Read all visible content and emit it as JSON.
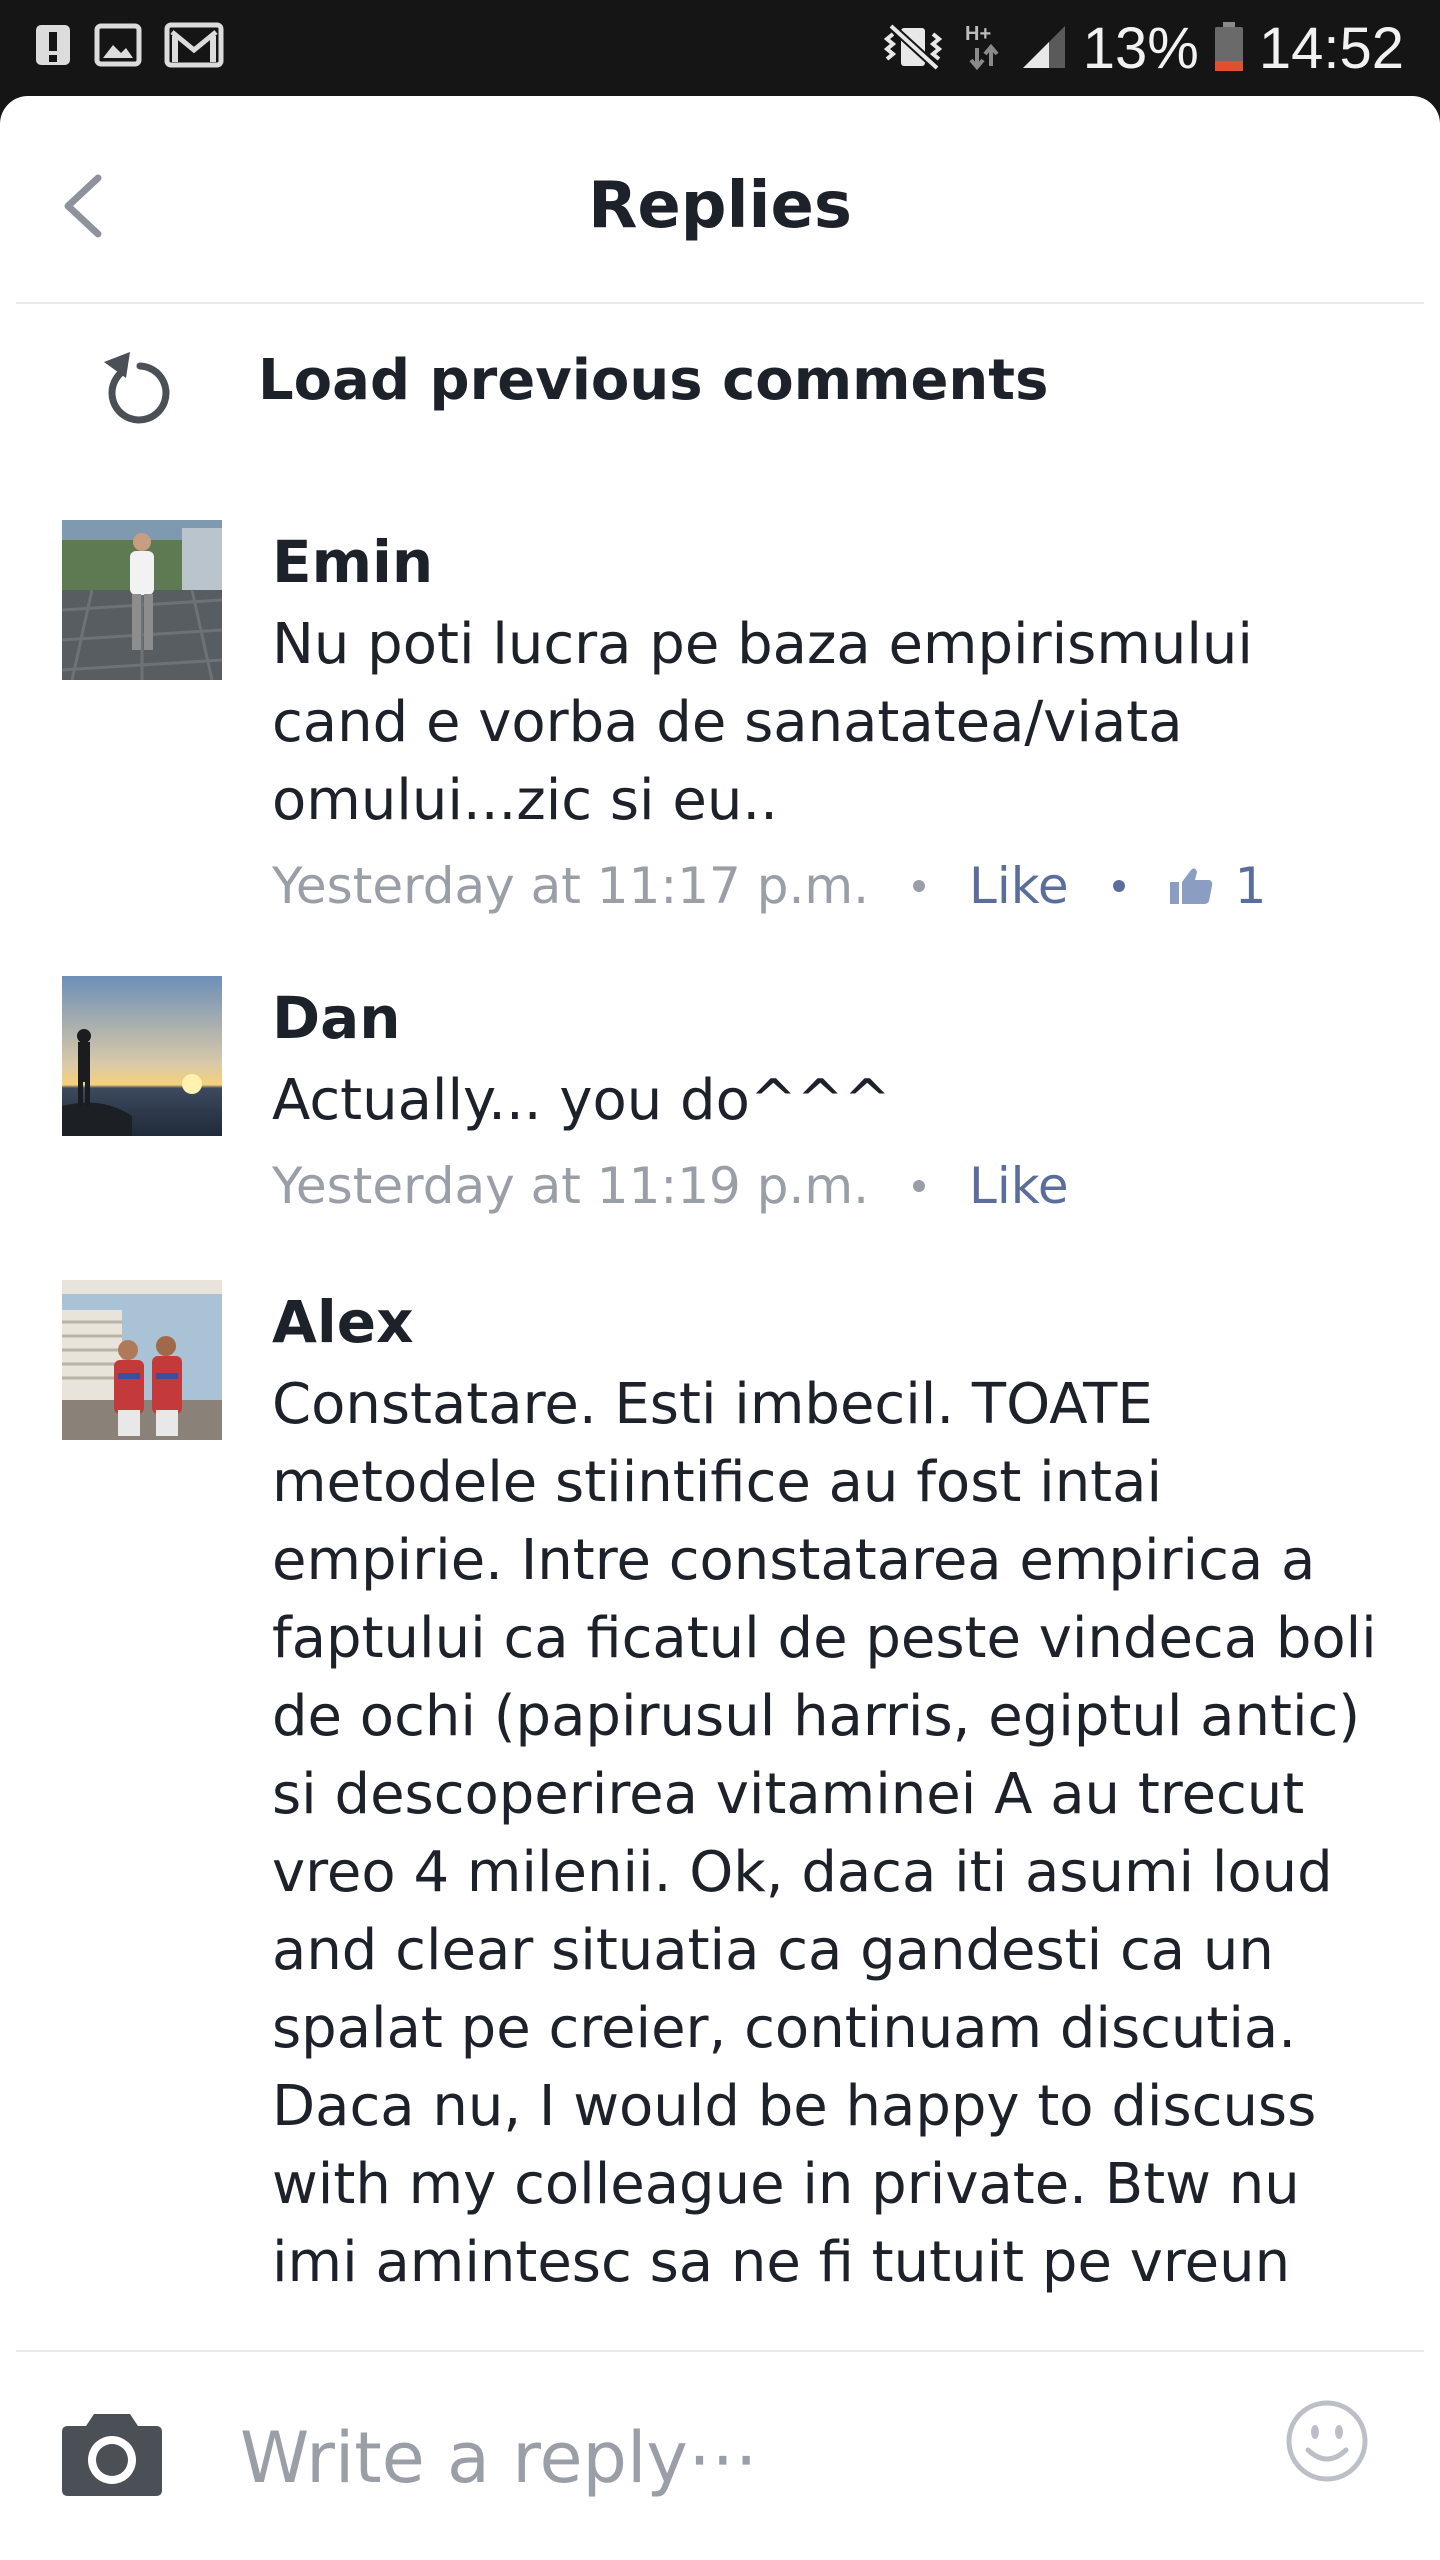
{
  "status_bar": {
    "battery_percent": "13%",
    "time": "14:52",
    "network": "H+",
    "icons": [
      "alert-icon",
      "gallery-icon",
      "mail-icon",
      "vibrate-mute-icon",
      "network-data-icon",
      "signal-icon",
      "battery-low-icon"
    ]
  },
  "header": {
    "title": "Replies",
    "back_icon": "chevron-left-icon"
  },
  "load_previous": {
    "label": "Load previous comments",
    "icon": "refresh-icon"
  },
  "comments": [
    {
      "name": "Emin",
      "text": "Nu poti lucra pe baza empirismului cand e vorba de sanatatea/viata omului...zic si eu..",
      "time": "Yesterday at 11:17 p.m.",
      "like_label": "Like",
      "like_count": "1"
    },
    {
      "name": "Dan",
      "text": "Actually... you do^^^",
      "time": "Yesterday at 11:19 p.m.",
      "like_label": "Like"
    },
    {
      "name": "Alex",
      "text": "Constatare. Esti imbecil. TOATE metodele stiintifice au fost intai empirie. Intre constatarea empirica a faptului ca ficatul de peste vindeca boli de ochi (papirusul harris, egiptul antic) si descoperirea vitaminei A au trecut vreo 4 milenii. Ok, daca iti asumi loud and clear situatia ca gandesti ca un spalat pe creier, continuam discutia. Daca nu, I would be happy to discuss with my colleague in private. Btw nu imi amintesc sa ne fi tutuit pe vreun"
    }
  ],
  "composer": {
    "placeholder": "Write a reply⋯",
    "camera_icon": "camera-icon",
    "emoji_icon": "smiley-icon"
  },
  "colors": {
    "accent": "#5b6d9b",
    "text": "#1d2129",
    "muted": "#9a9ea6",
    "status_bar_bg": "#151515",
    "battery_low": "#e0522e"
  }
}
